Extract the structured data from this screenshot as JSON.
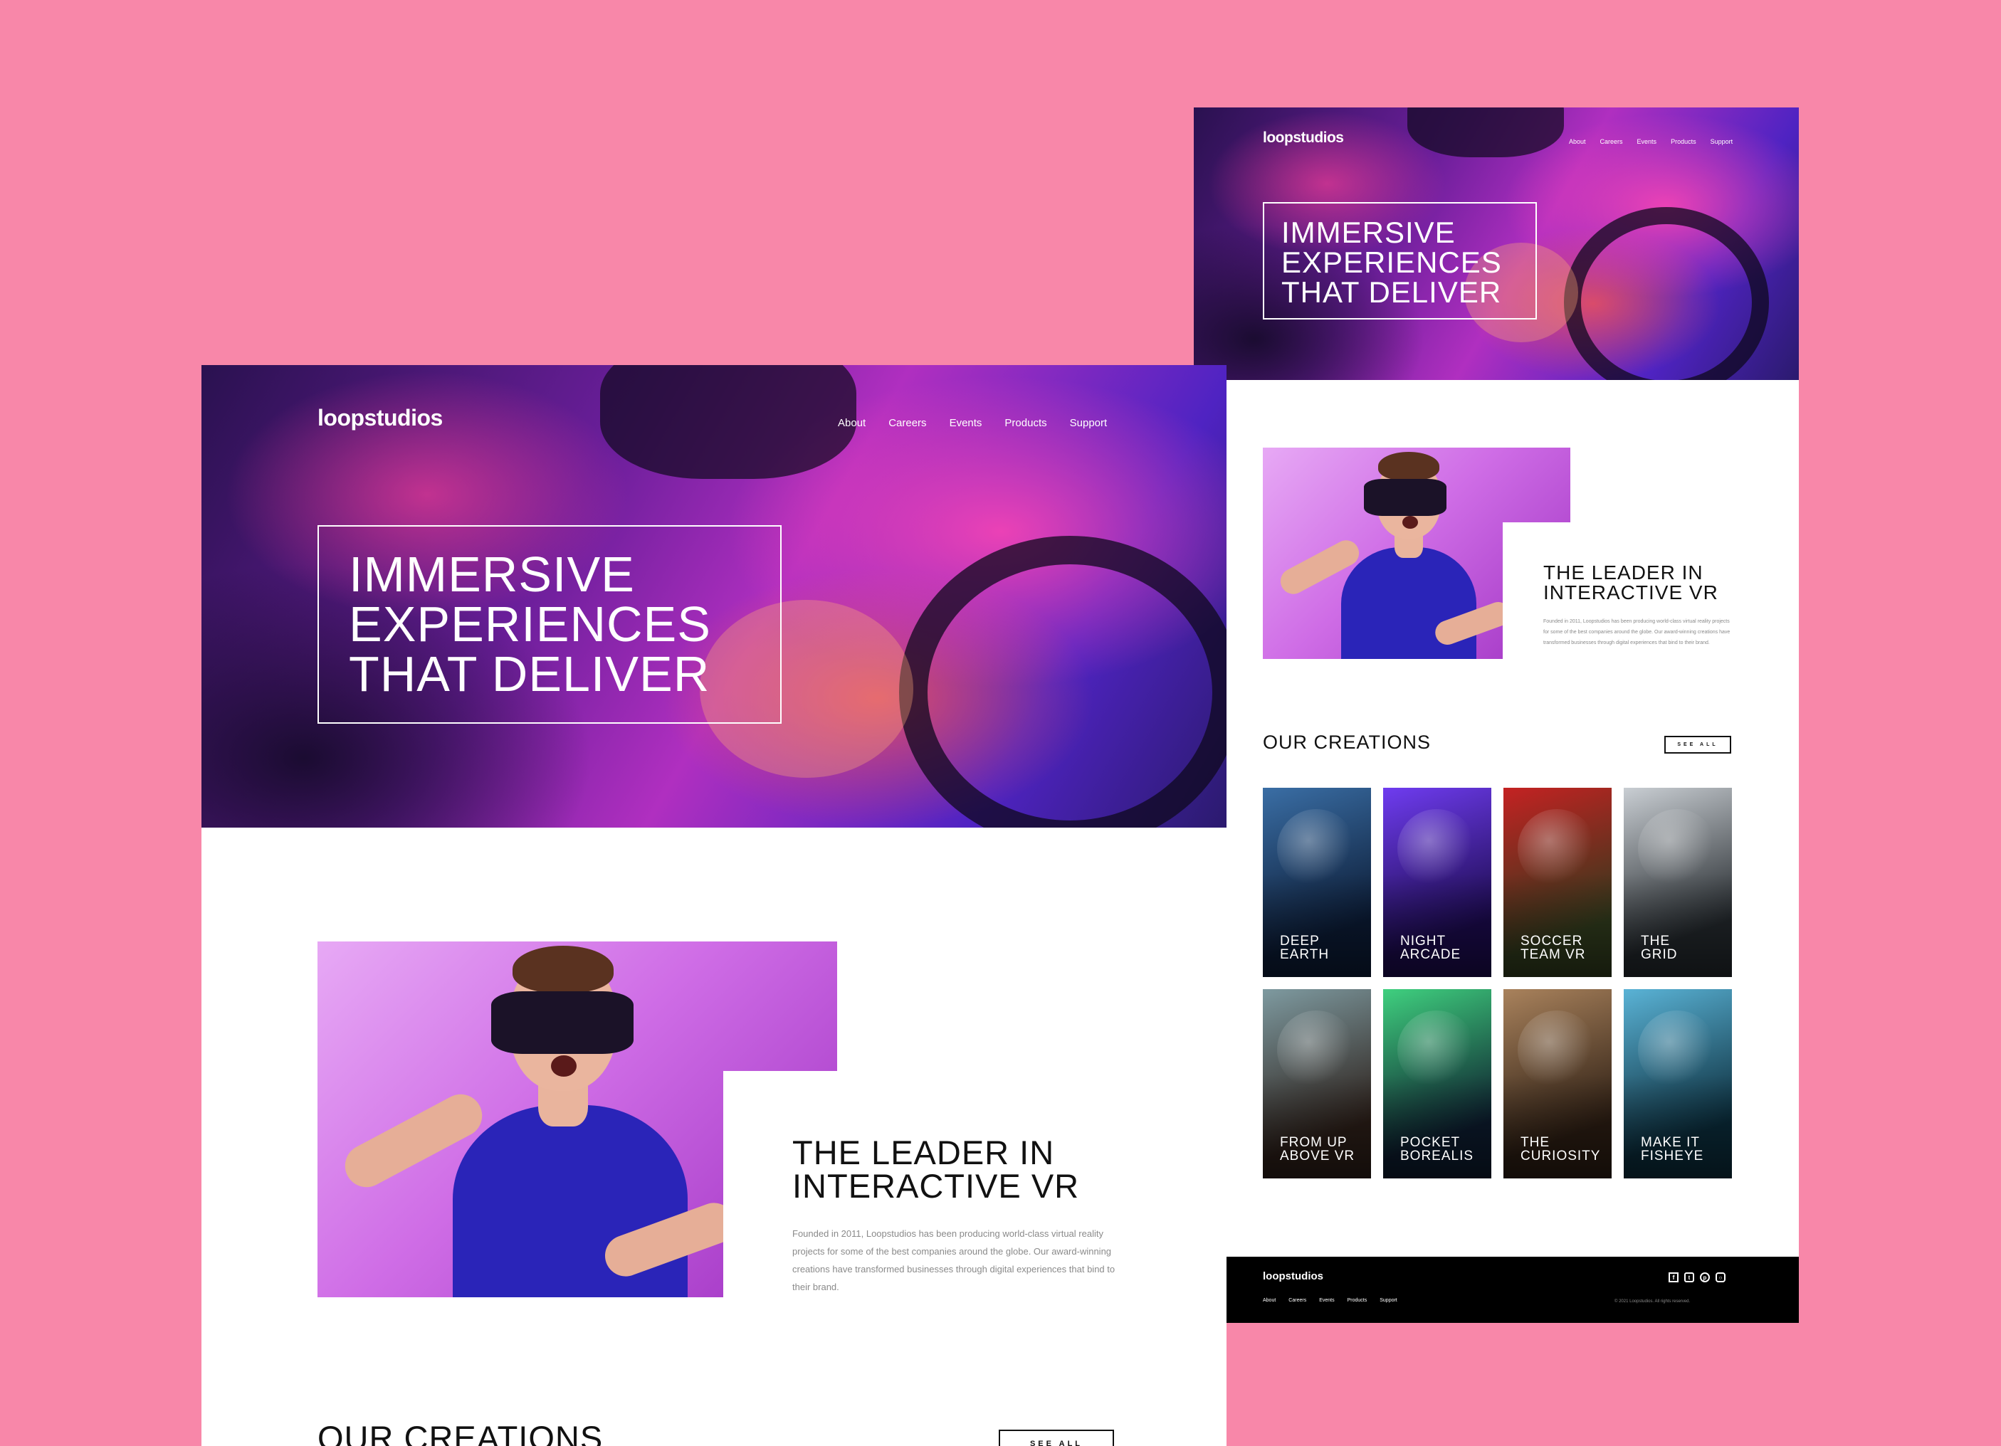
{
  "brand": {
    "logo": "loopstudios"
  },
  "nav": [
    "About",
    "Careers",
    "Events",
    "Products",
    "Support"
  ],
  "hero": {
    "lines": [
      "IMMERSIVE",
      "EXPERIENCES",
      "THAT DELIVER"
    ]
  },
  "leader": {
    "title_lines": [
      "THE LEADER IN",
      "INTERACTIVE VR"
    ],
    "text": "Founded in 2011, Loopstudios has been producing world-class virtual reality projects for some of the best companies around the globe. Our award-winning creations have transformed businesses through digital experiences that bind to their brand."
  },
  "creations": {
    "title": "OUR CREATIONS",
    "see_all": "SEE ALL",
    "items": [
      {
        "lines": [
          "Deep",
          "Earth"
        ],
        "icon": "earth-image",
        "colors": [
          "#0b1a33",
          "#3a6ea5"
        ]
      },
      {
        "lines": [
          "Night",
          "Arcade"
        ],
        "icon": "arcade-image",
        "colors": [
          "#1a0a4a",
          "#6f3cf0"
        ]
      },
      {
        "lines": [
          "Soccer",
          "Team VR"
        ],
        "icon": "soccer-image",
        "colors": [
          "#2f3a1c",
          "#c42222"
        ]
      },
      {
        "lines": [
          "The",
          "Grid"
        ],
        "icon": "car-image",
        "colors": [
          "#22272b",
          "#c9ced3"
        ]
      },
      {
        "lines": [
          "From Up",
          "Above VR"
        ],
        "icon": "aerial-image",
        "colors": [
          "#2a1d17",
          "#7e9aa0"
        ]
      },
      {
        "lines": [
          "Pocket",
          "Borealis"
        ],
        "icon": "aurora-image",
        "colors": [
          "#0c1a2c",
          "#3fd07f"
        ]
      },
      {
        "lines": [
          "The",
          "Curiosity"
        ],
        "icon": "rover-image",
        "colors": [
          "#2a1c12",
          "#a9825c"
        ]
      },
      {
        "lines": [
          "Make it",
          "Fisheye"
        ],
        "icon": "fisheye-image",
        "colors": [
          "#0a2a38",
          "#5ab3d6"
        ]
      }
    ]
  },
  "footer": {
    "logo": "loopstudios",
    "nav": [
      "About",
      "Careers",
      "Events",
      "Products",
      "Support"
    ],
    "social": [
      "facebook-icon",
      "twitter-icon",
      "pinterest-icon",
      "instagram-icon"
    ],
    "copyright": "© 2021 Loopstudios. All rights reserved."
  },
  "colors": {
    "background": "#f887a9",
    "text_dark": "#111111",
    "text_gray": "#8a8a8a"
  }
}
